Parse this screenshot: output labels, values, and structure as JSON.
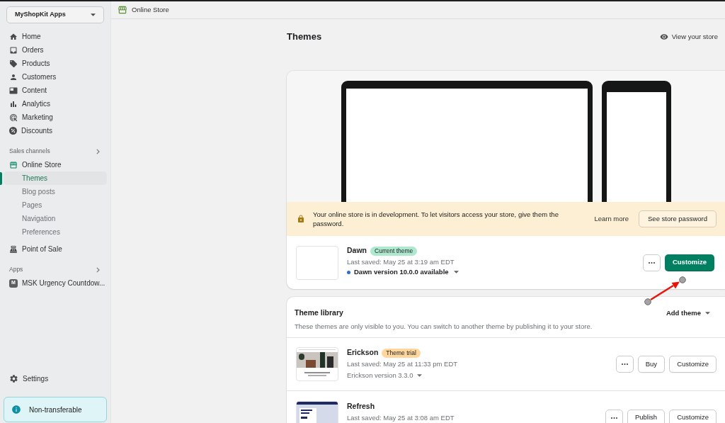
{
  "sidebar": {
    "store_selector": {
      "label": "MyShopKit Apps"
    },
    "main_nav": [
      {
        "label": "Home",
        "selected": false
      },
      {
        "label": "Orders",
        "selected": false
      },
      {
        "label": "Products",
        "selected": false
      },
      {
        "label": "Customers",
        "selected": false
      },
      {
        "label": "Content",
        "selected": false
      },
      {
        "label": "Analytics",
        "selected": false
      },
      {
        "label": "Marketing",
        "selected": false
      },
      {
        "label": "Discounts",
        "selected": false
      }
    ],
    "sales_channels": {
      "heading": "Sales channels",
      "items": [
        {
          "label": "Online Store",
          "selected": false,
          "children": [
            {
              "label": "Themes",
              "selected": true
            },
            {
              "label": "Blog posts",
              "selected": false
            },
            {
              "label": "Pages",
              "selected": false
            },
            {
              "label": "Navigation",
              "selected": false
            },
            {
              "label": "Preferences",
              "selected": false
            }
          ]
        },
        {
          "label": "Point of Sale",
          "selected": false
        }
      ]
    },
    "apps": {
      "heading": "Apps",
      "items": [
        {
          "label": "MSK Urgency Countdow...",
          "icon_letter": "M",
          "selected": false
        }
      ]
    },
    "settings": {
      "label": "Settings",
      "selected": false
    },
    "notice": {
      "label": "Non-transferable"
    }
  },
  "top_bar": {
    "title": "Online Store"
  },
  "page": {
    "title": "Themes",
    "view_store_link": "View your store"
  },
  "current_theme": {
    "banner": {
      "message": "Your online store is in development. To let visitors access your store, give them the password.",
      "link": "Learn more",
      "button": "See store password"
    },
    "thumbnail": {
      "kind": "blank"
    },
    "name": "Dawn",
    "badge": {
      "label": "Current theme",
      "kind": "success"
    },
    "last_saved": "Last saved: May 25 at 3:19 am EDT",
    "update": "Dawn version 10.0.0 available",
    "actions": [
      {
        "label": "Customize",
        "kind": "primary"
      }
    ]
  },
  "theme_library": {
    "title": "Theme library",
    "add_button": "Add theme",
    "description": "These themes are only visible to you. You can switch to another theme by publishing it to your store.",
    "themes": [
      {
        "thumbnail": {
          "kind": "lifestyle"
        },
        "name": "Erickson",
        "badge": {
          "label": "Theme trial",
          "kind": "attention"
        },
        "last_saved": "Last saved: May 25 at 11:33 pm EDT",
        "version": "Erickson version 3.3.0",
        "actions": [
          {
            "label": "Buy",
            "kind": "secondary"
          },
          {
            "label": "Customize",
            "kind": "secondary"
          }
        ]
      },
      {
        "thumbnail": {
          "kind": "catalog"
        },
        "name": "Refresh",
        "last_saved": "Last saved: May 25 at 3:08 am EDT",
        "actions": [
          {
            "label": "Publish",
            "kind": "secondary"
          },
          {
            "label": "Customize",
            "kind": "secondary"
          }
        ]
      }
    ]
  }
}
